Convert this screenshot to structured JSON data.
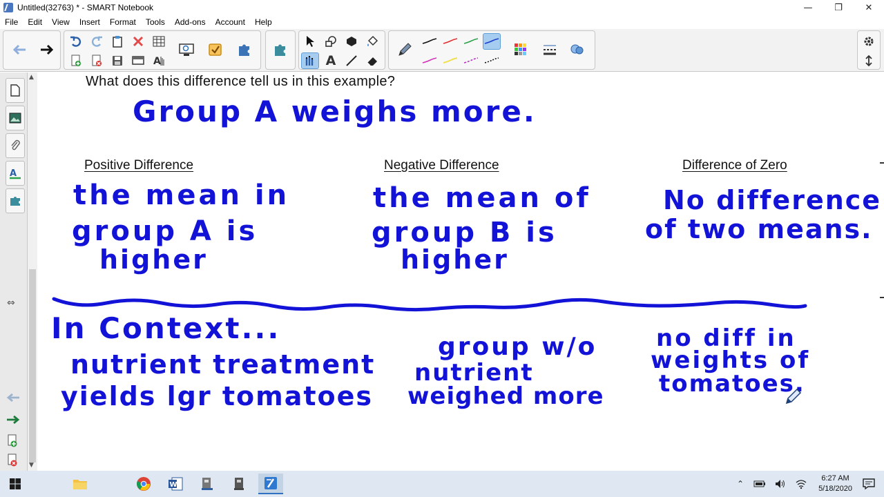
{
  "window": {
    "title": "Untitled(32763) * - SMART Notebook",
    "minimize": "—",
    "restore": "❐",
    "close": "✕"
  },
  "menu": [
    "File",
    "Edit",
    "View",
    "Insert",
    "Format",
    "Tools",
    "Add-ons",
    "Account",
    "Help"
  ],
  "toolbar": {
    "back": "🡐",
    "forward": "🡒",
    "text_tool_glyph": "A"
  },
  "sidetabs": {
    "arrows_glyph": "⇔"
  },
  "canvas": {
    "question": "What does this difference tell us in this example?",
    "answer_ink": "Group A weighs more.",
    "columns": [
      {
        "heading": "Positive Difference",
        "ink_lines": [
          "the mean in",
          "group A  is",
          "higher"
        ]
      },
      {
        "heading": "Negative Difference",
        "ink_lines": [
          "the mean of",
          "group B is",
          "higher"
        ]
      },
      {
        "heading": "Difference of Zero",
        "ink_lines": [
          "No difference",
          "of two means."
        ]
      }
    ],
    "context_heading_ink": "In Context...",
    "context": [
      {
        "ink_lines": [
          "nutrient treatment",
          "yields lgr tomatoes"
        ]
      },
      {
        "ink_lines": [
          "group w/o",
          "nutrient",
          "weighed more"
        ]
      },
      {
        "ink_lines": [
          "no diff in",
          "weights of",
          "tomatoes."
        ]
      }
    ],
    "ink_color": "#1313d8"
  },
  "taskbar": {
    "time": "6:27 AM",
    "date": "5/18/2020"
  }
}
